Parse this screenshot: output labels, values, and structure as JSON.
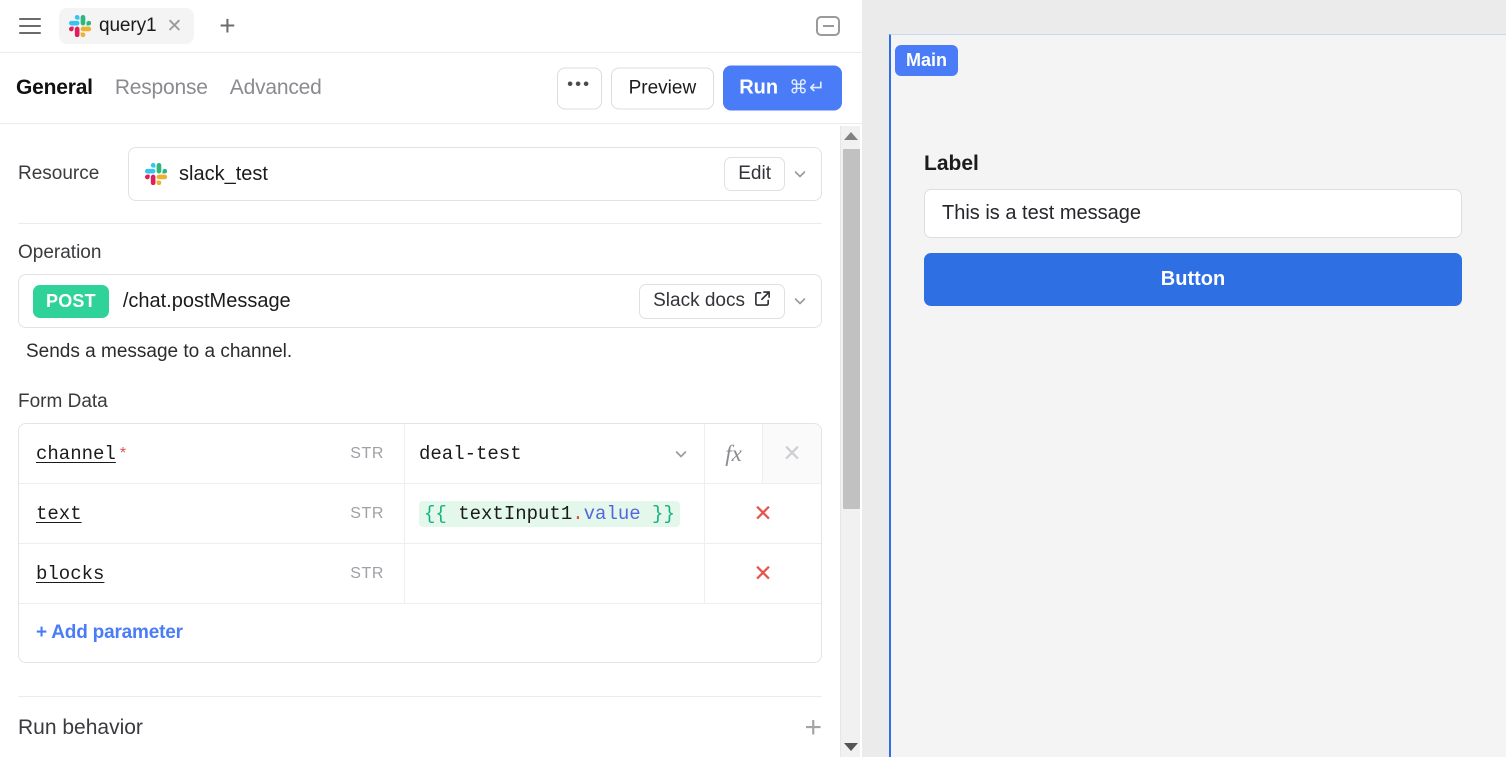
{
  "tabbar": {
    "menu_icon": "hamburger-icon",
    "tab_label": "query1",
    "tab_close": "✕",
    "add_tab": "+",
    "minimize": "minimize-icon"
  },
  "toolbar": {
    "tabs": [
      {
        "label": "General",
        "active": true
      },
      {
        "label": "Response",
        "active": false
      },
      {
        "label": "Advanced",
        "active": false
      }
    ],
    "more_label": "•••",
    "preview_label": "Preview",
    "run_label": "Run",
    "run_shortcut": "⌘↵"
  },
  "resource": {
    "label": "Resource",
    "value": "slack_test",
    "icon": "slack-icon",
    "edit_label": "Edit"
  },
  "operation": {
    "label": "Operation",
    "method": "POST",
    "path": "/chat.postMessage",
    "docs_label": "Slack docs",
    "description": "Sends a message to a channel."
  },
  "form_data": {
    "label": "Form Data",
    "rows": [
      {
        "key": "channel",
        "required": "*",
        "type": "STR",
        "value": "deal-test",
        "has_dropdown": true,
        "has_fx": true,
        "remove_enabled": false
      },
      {
        "key": "text",
        "required": "",
        "type": "STR",
        "expr_open": "{{",
        "expr_id": " textInput1",
        "expr_dot": ".",
        "expr_prop": "value",
        "expr_close": " }}",
        "has_dropdown": false,
        "has_fx": false,
        "remove_enabled": true
      },
      {
        "key": "blocks",
        "required": "",
        "type": "STR",
        "value": "",
        "has_dropdown": false,
        "has_fx": false,
        "remove_enabled": true
      }
    ],
    "add_parameter_label": "+ Add parameter"
  },
  "run_behavior": {
    "title": "Run behavior",
    "add": "+"
  },
  "canvas": {
    "frame_label": "Main",
    "widgets": {
      "label": "Label",
      "input_value": "This is a test message",
      "button_label": "Button"
    }
  },
  "colors": {
    "accent_blue": "#4a7cf7",
    "button_blue": "#2f6fe4",
    "post_green": "#2fd39a",
    "expr_bg": "#e3f8ea",
    "danger_red": "#e4564e"
  }
}
